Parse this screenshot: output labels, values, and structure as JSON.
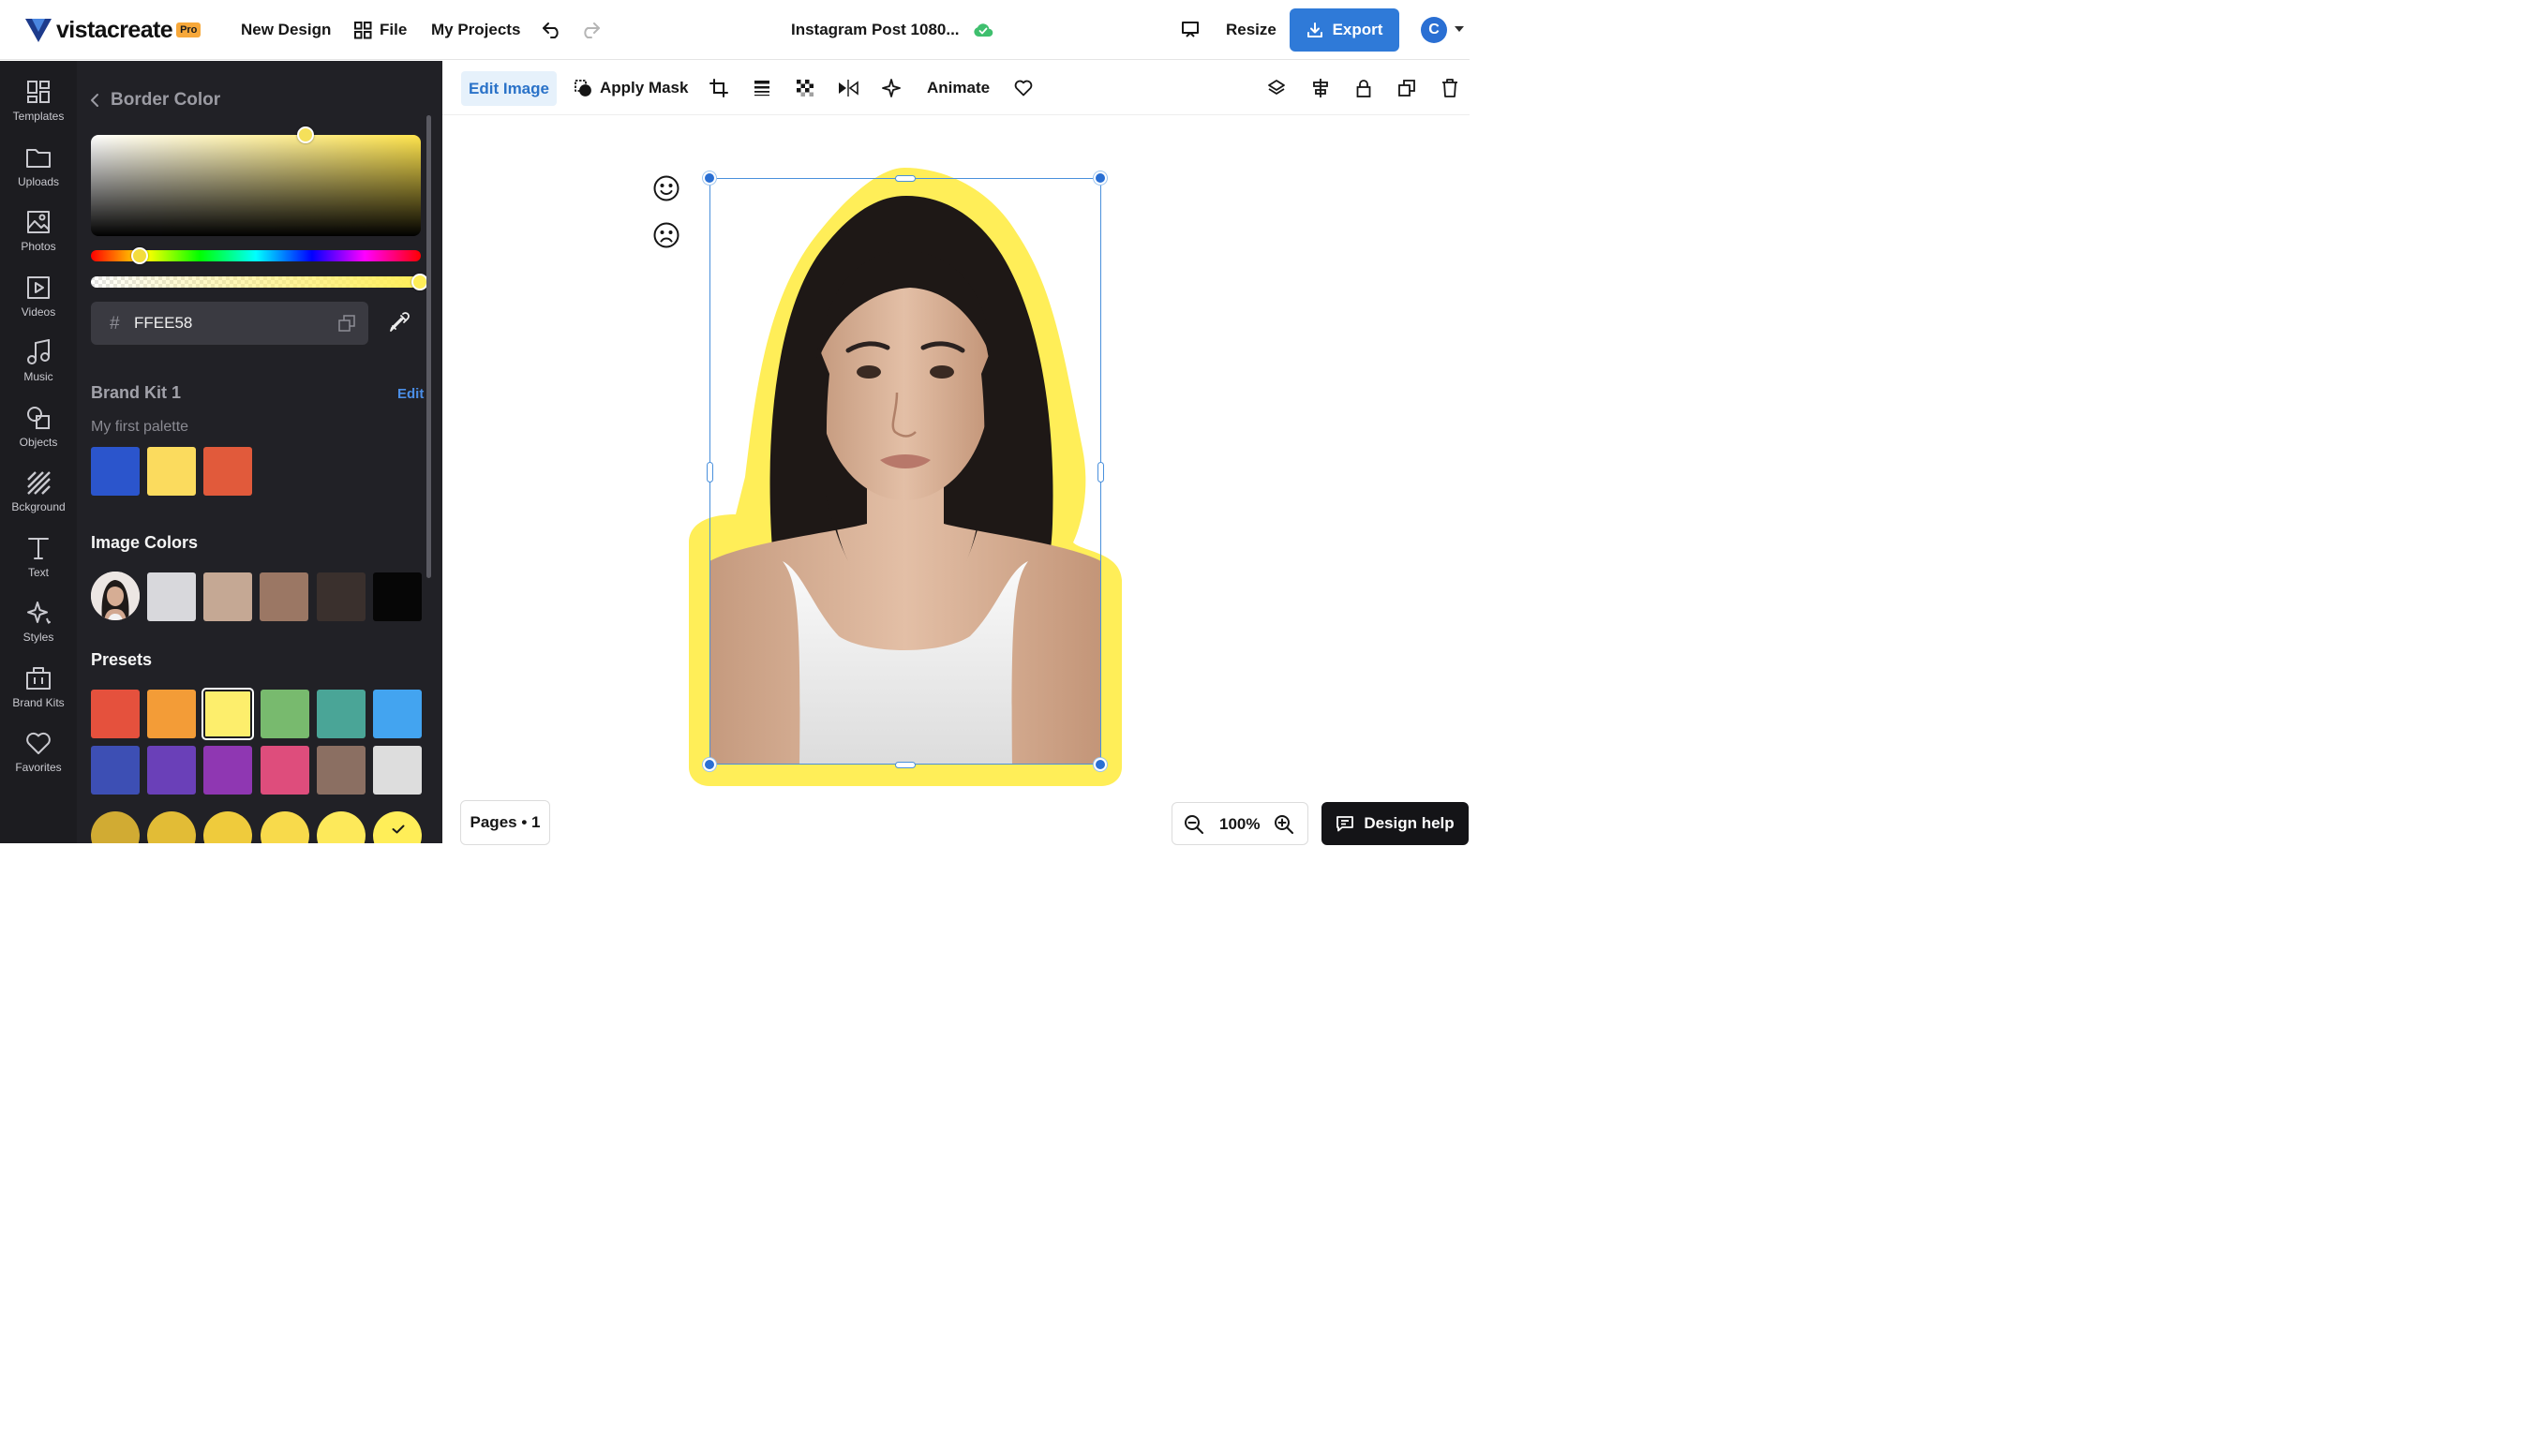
{
  "app": {
    "logo_word": "vistacreate",
    "logo_badge": "Pro"
  },
  "topbar": {
    "new_design": "New Design",
    "file": "File",
    "my_projects": "My Projects",
    "doc_title": "Instagram Post 1080...",
    "resize": "Resize",
    "export": "Export",
    "avatar_initial": "C"
  },
  "rail": {
    "items": [
      {
        "label": "Templates",
        "icon": "templates-icon"
      },
      {
        "label": "Uploads",
        "icon": "folder-icon"
      },
      {
        "label": "Photos",
        "icon": "image-icon"
      },
      {
        "label": "Videos",
        "icon": "video-icon"
      },
      {
        "label": "Music",
        "icon": "music-icon"
      },
      {
        "label": "Objects",
        "icon": "shapes-icon"
      },
      {
        "label": "Bckground",
        "icon": "background-icon"
      },
      {
        "label": "Text",
        "icon": "text-icon"
      },
      {
        "label": "Styles",
        "icon": "sparkle-icon"
      },
      {
        "label": "Brand Kits",
        "icon": "briefcase-icon"
      },
      {
        "label": "Favorites",
        "icon": "heart-icon"
      }
    ]
  },
  "panel": {
    "title": "Border Color",
    "hex_hash": "#",
    "hex_value": "FFEE58",
    "brand_kit_title": "Brand Kit 1",
    "brand_kit_edit": "Edit",
    "palette_name": "My first palette",
    "brand_colors": [
      "#2b55cc",
      "#fbdb5e",
      "#e15a3b"
    ],
    "image_colors_title": "Image Colors",
    "image_colors": [
      "#d8d8dc",
      "#c5a894",
      "#9b7764",
      "#3a302d",
      "#060606"
    ],
    "presets_title": "Presets",
    "presets": [
      "#e5513d",
      "#f39c37",
      "#fdee6c",
      "#78ba6e",
      "#4aa597",
      "#43a4f0",
      "#3d4fb4",
      "#6a40b8",
      "#8f37b2",
      "#de4d7c",
      "#8b6f62",
      "#dddddd"
    ],
    "selected_preset": 2,
    "yellow_shades": [
      "#d1ab33",
      "#e2bc36",
      "#efcb3c",
      "#f8da4b",
      "#fde95a",
      "#ffee58"
    ],
    "selected_shade": 5
  },
  "toolbar": {
    "edit_image": "Edit Image",
    "apply_mask": "Apply Mask",
    "animate": "Animate"
  },
  "canvas": {
    "border_color": "#ffee58",
    "accent": "#2f7ad8"
  },
  "footer": {
    "pages": "Pages • 1",
    "zoom": "100%",
    "design_help": "Design help"
  }
}
